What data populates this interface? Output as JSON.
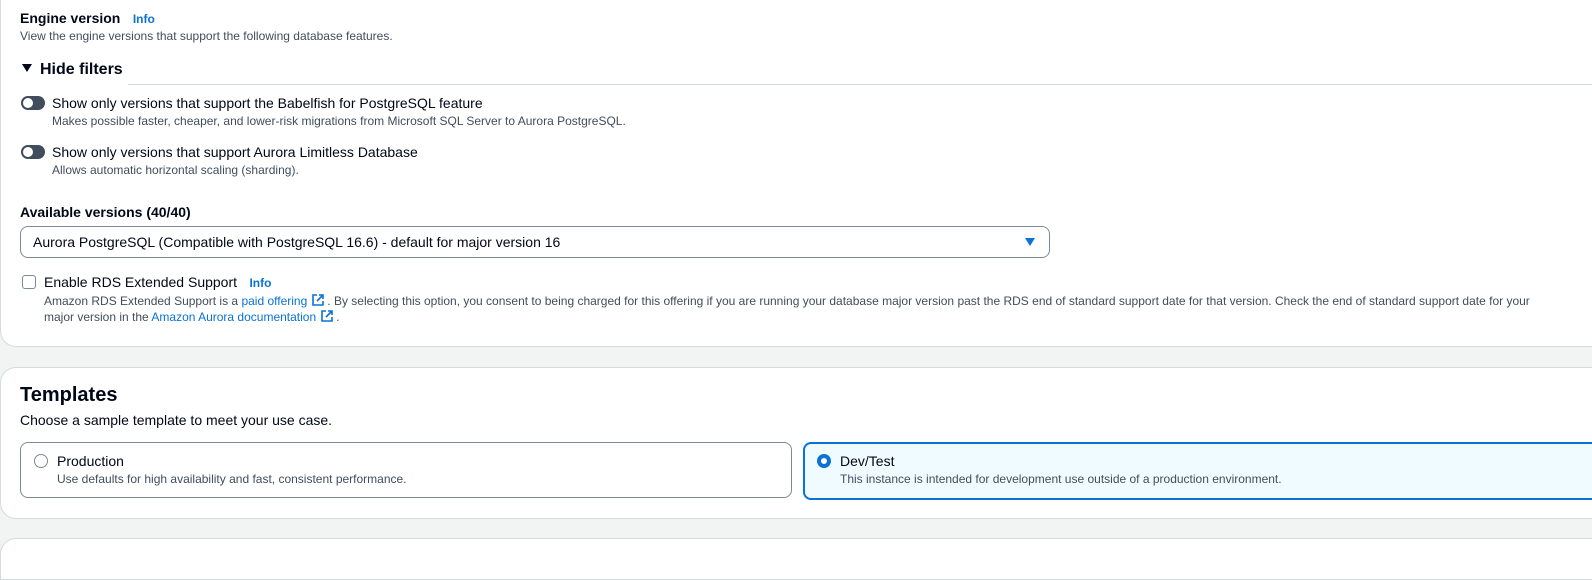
{
  "engine_version": {
    "label": "Engine version",
    "info": "Info",
    "description": "View the engine versions that support the following database features."
  },
  "filters": {
    "toggle_label": "Hide filters",
    "options": [
      {
        "label": "Show only versions that support the Babelfish for PostgreSQL feature",
        "description": "Makes possible faster, cheaper, and lower-risk migrations from Microsoft SQL Server to Aurora PostgreSQL.",
        "enabled": false
      },
      {
        "label": "Show only versions that support Aurora Limitless Database",
        "description": "Allows automatic horizontal scaling (sharding).",
        "enabled": false
      }
    ]
  },
  "available_versions": {
    "label": "Available versions (40/40)",
    "selected": "Aurora PostgreSQL (Compatible with PostgreSQL 16.6) - default for major version 16"
  },
  "extended_support": {
    "label": "Enable RDS Extended Support",
    "info": "Info",
    "checked": false,
    "desc_part1": "Amazon RDS Extended Support is a",
    "link1": "paid offering",
    "desc_part2": ". By selecting this option, you consent to being charged for this offering if you are running your database major version past the RDS end of standard support date for that version. Check the end of standard support date for your",
    "desc_part3": "major version in the",
    "link2": "Amazon Aurora documentation",
    "desc_part4": "."
  },
  "templates": {
    "title": "Templates",
    "description": "Choose a sample template to meet your use case.",
    "options": [
      {
        "label": "Production",
        "description": "Use defaults for high availability and fast, consistent performance.",
        "selected": false
      },
      {
        "label": "Dev/Test",
        "description": "This instance is intended for development use outside of a production environment.",
        "selected": true
      }
    ]
  },
  "colors": {
    "link": "#0972d3",
    "text": "#000716",
    "secondary_text": "#414d5c",
    "border": "#7d8998",
    "selected_bg": "#f0fbff"
  }
}
